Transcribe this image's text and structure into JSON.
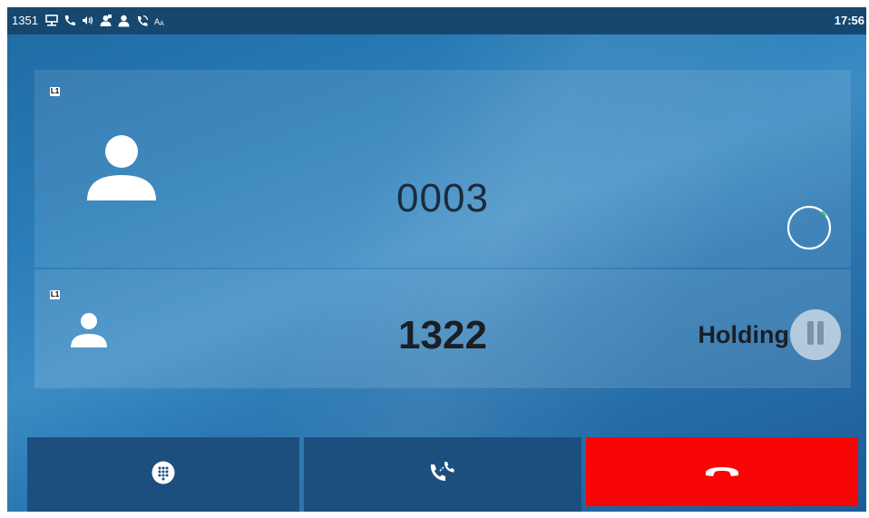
{
  "status_bar": {
    "extension": "1351",
    "icons": [
      "network-icon",
      "phone-icon",
      "volume-icon",
      "contact-icon",
      "user-icon",
      "voicemail-icon",
      "font-icon"
    ],
    "time": "17:56"
  },
  "active_call": {
    "line_badge": "L1",
    "number": "0003",
    "status_icon": "dialing-ring-icon"
  },
  "held_call": {
    "line_badge": "L1",
    "number": "1322",
    "status_label": "Holding"
  },
  "softkeys": {
    "dialpad": "dialpad-icon",
    "transfer": "transfer-icon",
    "end_call": "end-call-icon"
  },
  "colors": {
    "status_bar_bg": "#16486f",
    "end_call_bg": "#fa0505",
    "softkey_bg": "#1d4f7e",
    "ring_accent": "#2ecc40"
  }
}
